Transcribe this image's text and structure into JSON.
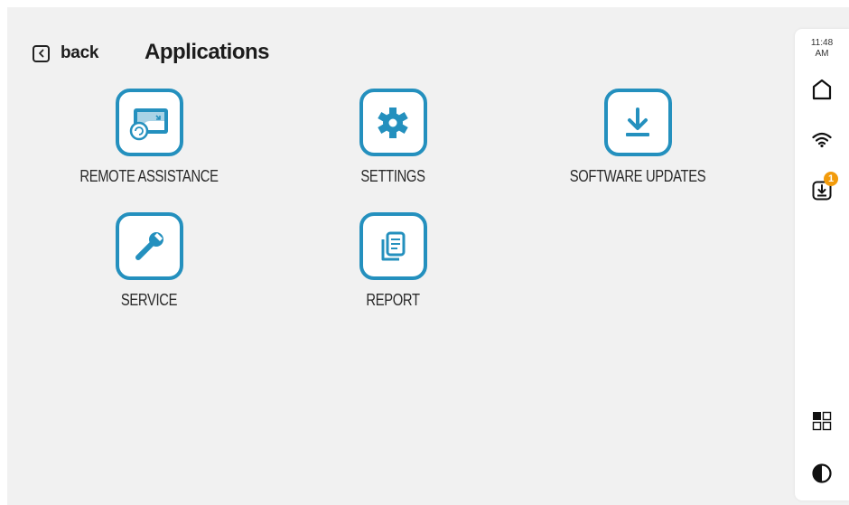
{
  "header": {
    "back_label": "back",
    "title": "Applications"
  },
  "apps": [
    {
      "label": "REMOTE ASSISTANCE",
      "icon": "remote-assistance-icon"
    },
    {
      "label": "SETTINGS",
      "icon": "gear-icon"
    },
    {
      "label": "SOFTWARE UPDATES",
      "icon": "download-icon"
    },
    {
      "label": "SERVICE",
      "icon": "wrench-icon"
    },
    {
      "label": "REPORT",
      "icon": "report-document-icon"
    }
  ],
  "status_bar": {
    "time": "11:48",
    "ampm": "AM",
    "update_badge_count": "1",
    "icons": [
      "home-icon",
      "wifi-icon",
      "software-update-icon",
      "app-grid-icon",
      "contrast-icon"
    ]
  },
  "colors": {
    "accent": "#2490be",
    "badge": "#f29b0b",
    "background": "#f1f1f1"
  }
}
